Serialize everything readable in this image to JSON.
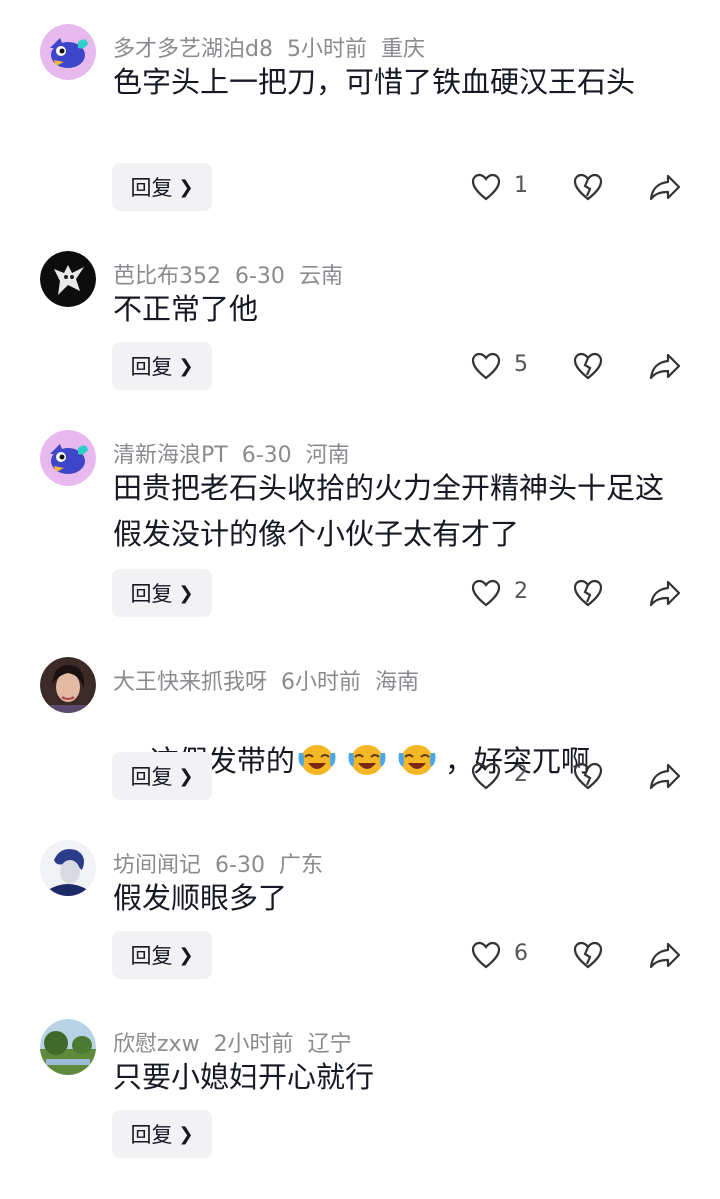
{
  "reply_label": "回复",
  "colors": {
    "meta": "#8b8b8f",
    "text": "#161823",
    "reply_bg": "#f2f2f4"
  },
  "comments": [
    {
      "name": "多才多艺湖泊d8",
      "time": "5小时前",
      "location": "重庆",
      "text": "色字头上一把刀，可惜了铁血硬汉王石头",
      "likes": "1",
      "avatar": "fish-avatar-icon"
    },
    {
      "name": "芭比布352",
      "time": "6-30",
      "location": "云南",
      "text": "不正常了他",
      "likes": "5",
      "avatar": "white-creature-avatar-icon"
    },
    {
      "name": "清新海浪PT",
      "time": "6-30",
      "location": "河南",
      "text": "田贵把老石头收拾的火力全开精神头十足这假发没计的像个小伙子太有才了",
      "likes": "2",
      "avatar": "fish-avatar-icon"
    },
    {
      "name": "大王快来抓我呀",
      "time": "6小时前",
      "location": "海南",
      "text_prefix": "这假发带的",
      "text_suffix": "，好突兀啊",
      "emoji_count": 3,
      "emoji": "laughing-crying-emoji-icon",
      "likes": "2",
      "avatar": "woman-portrait-avatar-icon"
    },
    {
      "name": "坊间闻记",
      "time": "6-30",
      "location": "广东",
      "text": "假发顺眼多了",
      "likes": "6",
      "avatar": "ink-portrait-avatar-icon"
    },
    {
      "name": "欣慰zxw",
      "time": "2小时前",
      "location": "辽宁",
      "text": "只要小媳妇开心就行",
      "likes": "",
      "avatar": "landscape-avatar-icon"
    }
  ]
}
